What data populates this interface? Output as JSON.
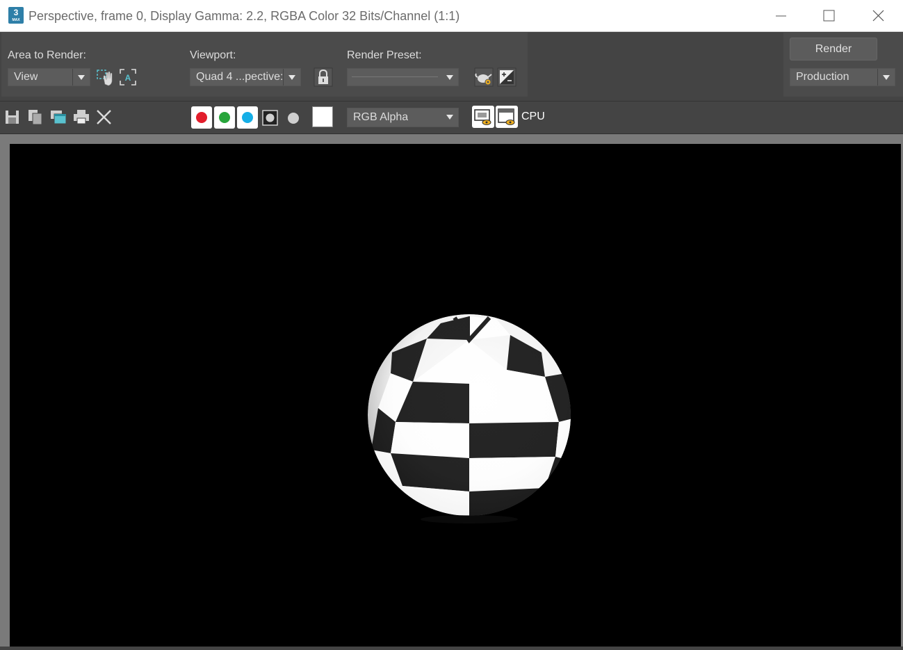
{
  "window": {
    "title": "Perspective, frame 0, Display Gamma: 2.2, RGBA Color 32 Bits/Channel (1:1)",
    "app_icon_text": "3",
    "app_icon_subtext": "MAX"
  },
  "area_to_render": {
    "label": "Area to Render:",
    "value": "View"
  },
  "viewport": {
    "label": "Viewport:",
    "value": "Quad 4 ...pective:"
  },
  "render_preset": {
    "label": "Render Preset:",
    "value": ""
  },
  "render": {
    "button_label": "Render",
    "mode": "Production"
  },
  "toolbar": {
    "channel_display": "RGB Alpha",
    "renderer_label": "CPU"
  },
  "colors": {
    "red_channel": "#e21d2b",
    "green_channel": "#27a53b",
    "blue_channel": "#15aee6",
    "panel_bg": "#4b4b4b",
    "canvas_bg": "#000000"
  }
}
